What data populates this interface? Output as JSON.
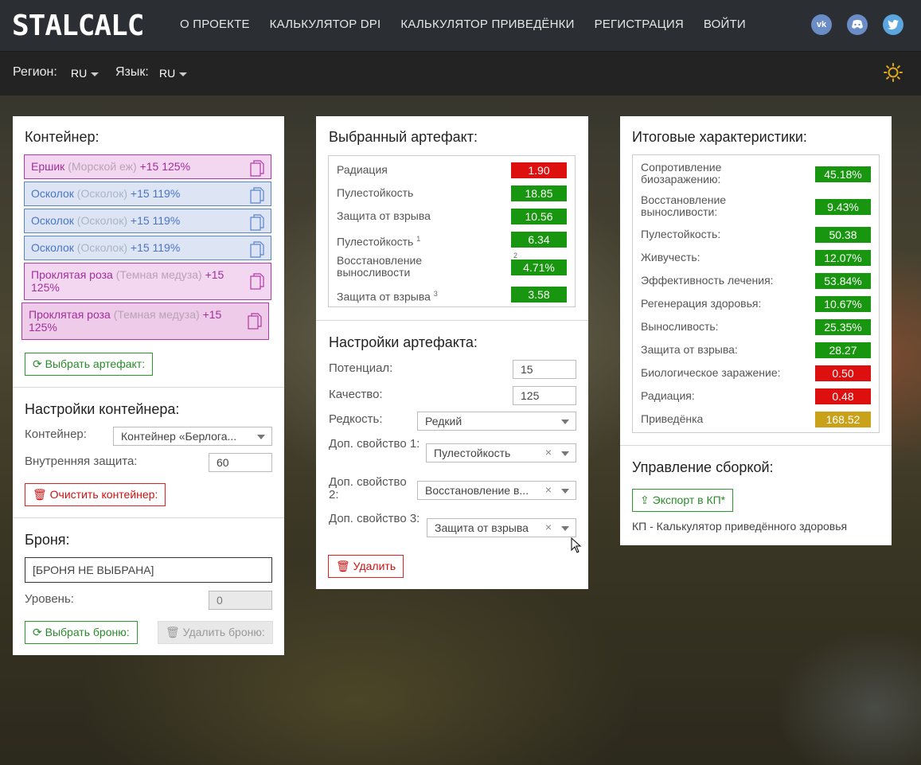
{
  "nav": {
    "logo": "STALCALC",
    "links": [
      "О ПРОЕКТЕ",
      "КАЛЬКУЛЯТОР DPI",
      "КАЛЬКУЛЯТОР ПРИВЕДЁНКИ",
      "РЕГИСТРАЦИЯ",
      "ВОЙТИ"
    ],
    "social_icons": [
      "vk-icon",
      "discord-icon",
      "twitter-icon"
    ]
  },
  "subbar": {
    "region_label": "Регион:",
    "region_value": "RU",
    "lang_label": "Язык:",
    "lang_value": "RU",
    "theme_icon": "sun-icon"
  },
  "container_panel": {
    "title": "Контейнер:",
    "artifacts": [
      {
        "name": "Ершик",
        "sub": "(Морской еж)",
        "tail": "+15 125%",
        "color": "pink"
      },
      {
        "name": "Осколок",
        "sub": "(Осколок)",
        "tail": "+15 119%",
        "color": "blue"
      },
      {
        "name": "Осколок",
        "sub": "(Осколок)",
        "tail": "+15 119%",
        "color": "blue"
      },
      {
        "name": "Осколок",
        "sub": "(Осколок)",
        "tail": "+15 119%",
        "color": "blue"
      },
      {
        "name": "Проклятая роза",
        "sub": "(Темная медуза)",
        "tail": "+15 125%",
        "color": "pink"
      },
      {
        "name": "Проклятая роза",
        "sub": "(Темная медуза)",
        "tail": "+15 125%",
        "color": "pink"
      }
    ],
    "select_artifact_btn": "Выбрать артефакт:",
    "settings_title": "Настройки контейнера:",
    "container_label": "Контейнер:",
    "container_value": "Контейнер «Берлога...",
    "inner_protection_label": "Внутренняя защита:",
    "inner_protection_value": "60",
    "clear_btn": "Очистить контейнер:",
    "armor_title": "Броня:",
    "armor_value": "[БРОНЯ НЕ ВЫБРАНА]",
    "level_label": "Уровень:",
    "level_value": "0",
    "select_armor_btn": "Выбрать броню:",
    "delete_armor_btn": "Удалить броню:"
  },
  "artifact_panel": {
    "title": "Выбранный артефакт:",
    "stats": [
      {
        "name": "Радиация",
        "value": "1.90",
        "color": "r",
        "sup": ""
      },
      {
        "name": "Пулестойкость",
        "value": "18.85",
        "color": "g",
        "sup": ""
      },
      {
        "name": "Защита от взрыва",
        "value": "10.56",
        "color": "g",
        "sup": ""
      },
      {
        "name": "Пулестойкость",
        "value": "6.34",
        "color": "g",
        "sup": "1"
      },
      {
        "name": "Восстановление выносливости",
        "value": "4.71%",
        "color": "g",
        "sup": "2"
      },
      {
        "name": "Защита от взрыва",
        "value": "3.58",
        "color": "g",
        "sup": "3"
      }
    ],
    "settings_title": "Настройки артефакта:",
    "potential_label": "Потенциал:",
    "potential_value": "15",
    "quality_label": "Качество:",
    "quality_value": "125",
    "rarity_label": "Редкость:",
    "rarity_value": "Редкий",
    "prop1_label": "Доп. свойство 1:",
    "prop1_value": "Пулестойкость",
    "prop2_label": "Доп. свойство 2:",
    "prop2_value": "Восстановление в...",
    "prop3_label": "Доп. свойство 3:",
    "prop3_value": "Защита от взрыва",
    "clear_x": "×",
    "delete_btn": "Удалить"
  },
  "result_panel": {
    "title": "Итоговые характеристики:",
    "stats": [
      {
        "name": "Сопротивление биозаражению:",
        "value": "45.18%",
        "color": "g"
      },
      {
        "name": "Восстановление выносливости:",
        "value": "9.43%",
        "color": "g"
      },
      {
        "name": "Пулестойкость:",
        "value": "50.38",
        "color": "g"
      },
      {
        "name": "Живучесть:",
        "value": "12.07%",
        "color": "g"
      },
      {
        "name": "Эффективность лечения:",
        "value": "53.84%",
        "color": "g"
      },
      {
        "name": "Регенерация здоровья:",
        "value": "10.67%",
        "color": "g"
      },
      {
        "name": "Выносливость:",
        "value": "25.35%",
        "color": "g"
      },
      {
        "name": "Защита от взрыва:",
        "value": "28.27",
        "color": "g"
      },
      {
        "name": "Биологическое заражение:",
        "value": "0.50",
        "color": "r"
      },
      {
        "name": "Радиация:",
        "value": "0.48",
        "color": "r"
      },
      {
        "name": "Приведёнка",
        "value": "168.52",
        "color": "y"
      }
    ],
    "build_title": "Управление сборкой:",
    "export_btn": "Экспорт в КП*",
    "footnote": "КП - Калькулятор приведённого здоровья"
  }
}
